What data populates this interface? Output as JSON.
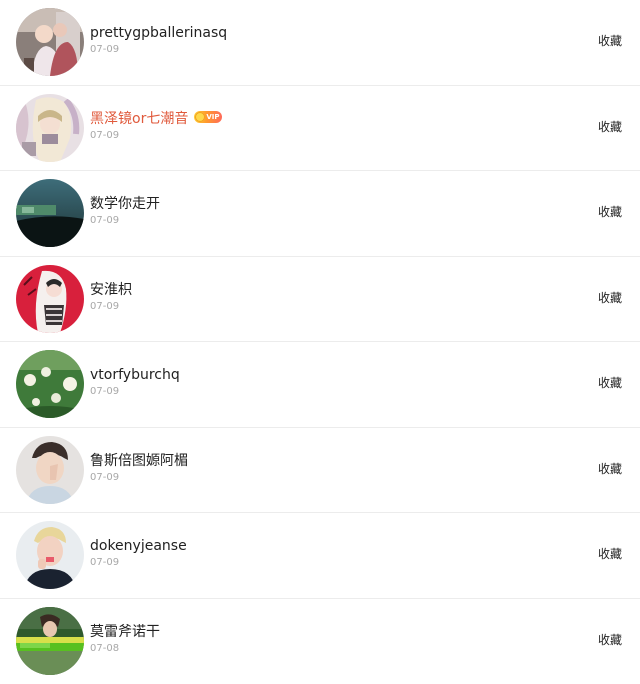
{
  "rows": [
    {
      "name": "prettygpballerinasq",
      "date": "07-09",
      "action": "收藏",
      "vip": false
    },
    {
      "name": "黑泽镜or七潮音",
      "date": "07-09",
      "action": "收藏",
      "vip": true,
      "vip_label": "VIP",
      "name_color": "#e05a3c"
    },
    {
      "name": "数学你走开",
      "date": "07-09",
      "action": "收藏",
      "vip": false
    },
    {
      "name": "安淮枳",
      "date": "07-09",
      "action": "收藏",
      "vip": false
    },
    {
      "name": "vtorfyburchq",
      "date": "07-09",
      "action": "收藏",
      "vip": false
    },
    {
      "name": "鲁斯倍图嫄阿楣",
      "date": "07-09",
      "action": "收藏",
      "vip": false
    },
    {
      "name": "dokenyjeanse",
      "date": "07-09",
      "action": "收藏",
      "vip": false
    },
    {
      "name": "莫雷斧诺干",
      "date": "07-08",
      "action": "收藏",
      "vip": false
    }
  ]
}
